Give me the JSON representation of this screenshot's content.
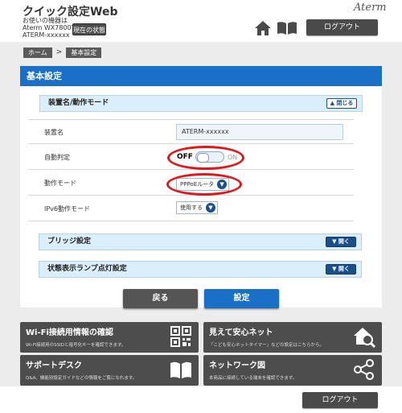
{
  "header": {
    "app_title": "クイック設定Web",
    "device_label": "お使いの機器は",
    "device_model": "Aterm WX7800T8",
    "device_name": "ATERM-xxxxxx",
    "status_button": "現在の状態",
    "brand": "Aterm",
    "logout": "ログアウト"
  },
  "breadcrumb": [
    "ホーム",
    ">",
    "基本設定"
  ],
  "panel": {
    "title": "基本設定",
    "section_main": {
      "title": "装置名/動作モード",
      "toggle_label": "閉じる"
    },
    "rows": [
      {
        "label": "装置名",
        "value": "ATERM-xxxxxx"
      },
      {
        "label": "自動判定",
        "off": "OFF",
        "on": "ON"
      },
      {
        "label": "動作モード",
        "value": "PPPoEルータ"
      },
      {
        "label": "IPv6動作モード",
        "value": "使用する"
      }
    ],
    "section_bridge": {
      "title": "ブリッジ設定",
      "toggle_label": "開く"
    },
    "section_lamp": {
      "title": "状態表示ランプ点灯設定",
      "toggle_label": "開く"
    }
  },
  "actions": {
    "back": "戻る",
    "apply": "設定"
  },
  "tiles": [
    {
      "title": "Wi-Fi接続用情報の確認",
      "sub": "Wi-Fi接続用のSSIDと暗号化キーを確認できます。",
      "icon": "qr-code-icon"
    },
    {
      "title": "見えて安心ネット",
      "sub": "「こども安心ネットタイマー」などの設定はこちらから。",
      "icon": "house-search-icon"
    },
    {
      "title": "サポートデスク",
      "sub": "Q&A、機能別設定ガイドなどの情報をご覧になれます。",
      "icon": "book-icon"
    },
    {
      "title": "ネットワーク図",
      "sub": "本商品に接続している端末を確認できます。",
      "icon": "network-diagram-icon"
    }
  ],
  "footer": {
    "logout": "ログアウト"
  },
  "colors": {
    "accent": "#1a6fc6",
    "dark_button": "#4d4d4d",
    "highlight": "#e0181b"
  }
}
